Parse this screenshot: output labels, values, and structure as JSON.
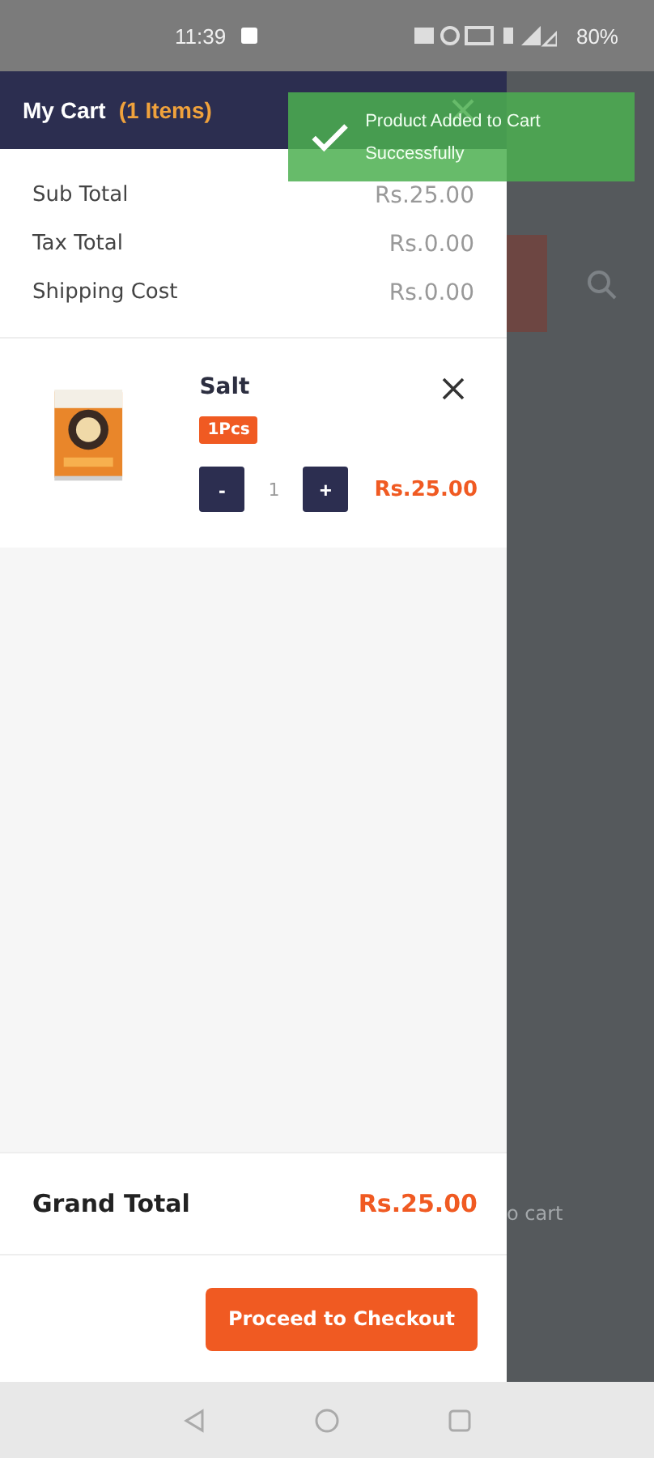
{
  "status_bar": {
    "time": "11:39",
    "battery": "80%"
  },
  "background": {
    "peek_text": "o cart"
  },
  "toast": {
    "message": "Product Added to Cart Successfully"
  },
  "cart": {
    "title": "My Cart",
    "count": "(1 Items)",
    "totals": [
      {
        "label": "Sub Total",
        "value": "Rs.25.00"
      },
      {
        "label": "Tax Total",
        "value": "Rs.0.00"
      },
      {
        "label": "Shipping Cost",
        "value": "Rs.0.00"
      }
    ],
    "items": [
      {
        "name": "Salt",
        "unit": "1Pcs",
        "minus": "-",
        "quantity": "1",
        "plus": "+",
        "price": "Rs.25.00",
        "kind": "picture"
      }
    ],
    "grand_total": {
      "label": "Grand Total",
      "value": "Rs.25.00"
    },
    "checkout": "Proceed to Checkout"
  }
}
